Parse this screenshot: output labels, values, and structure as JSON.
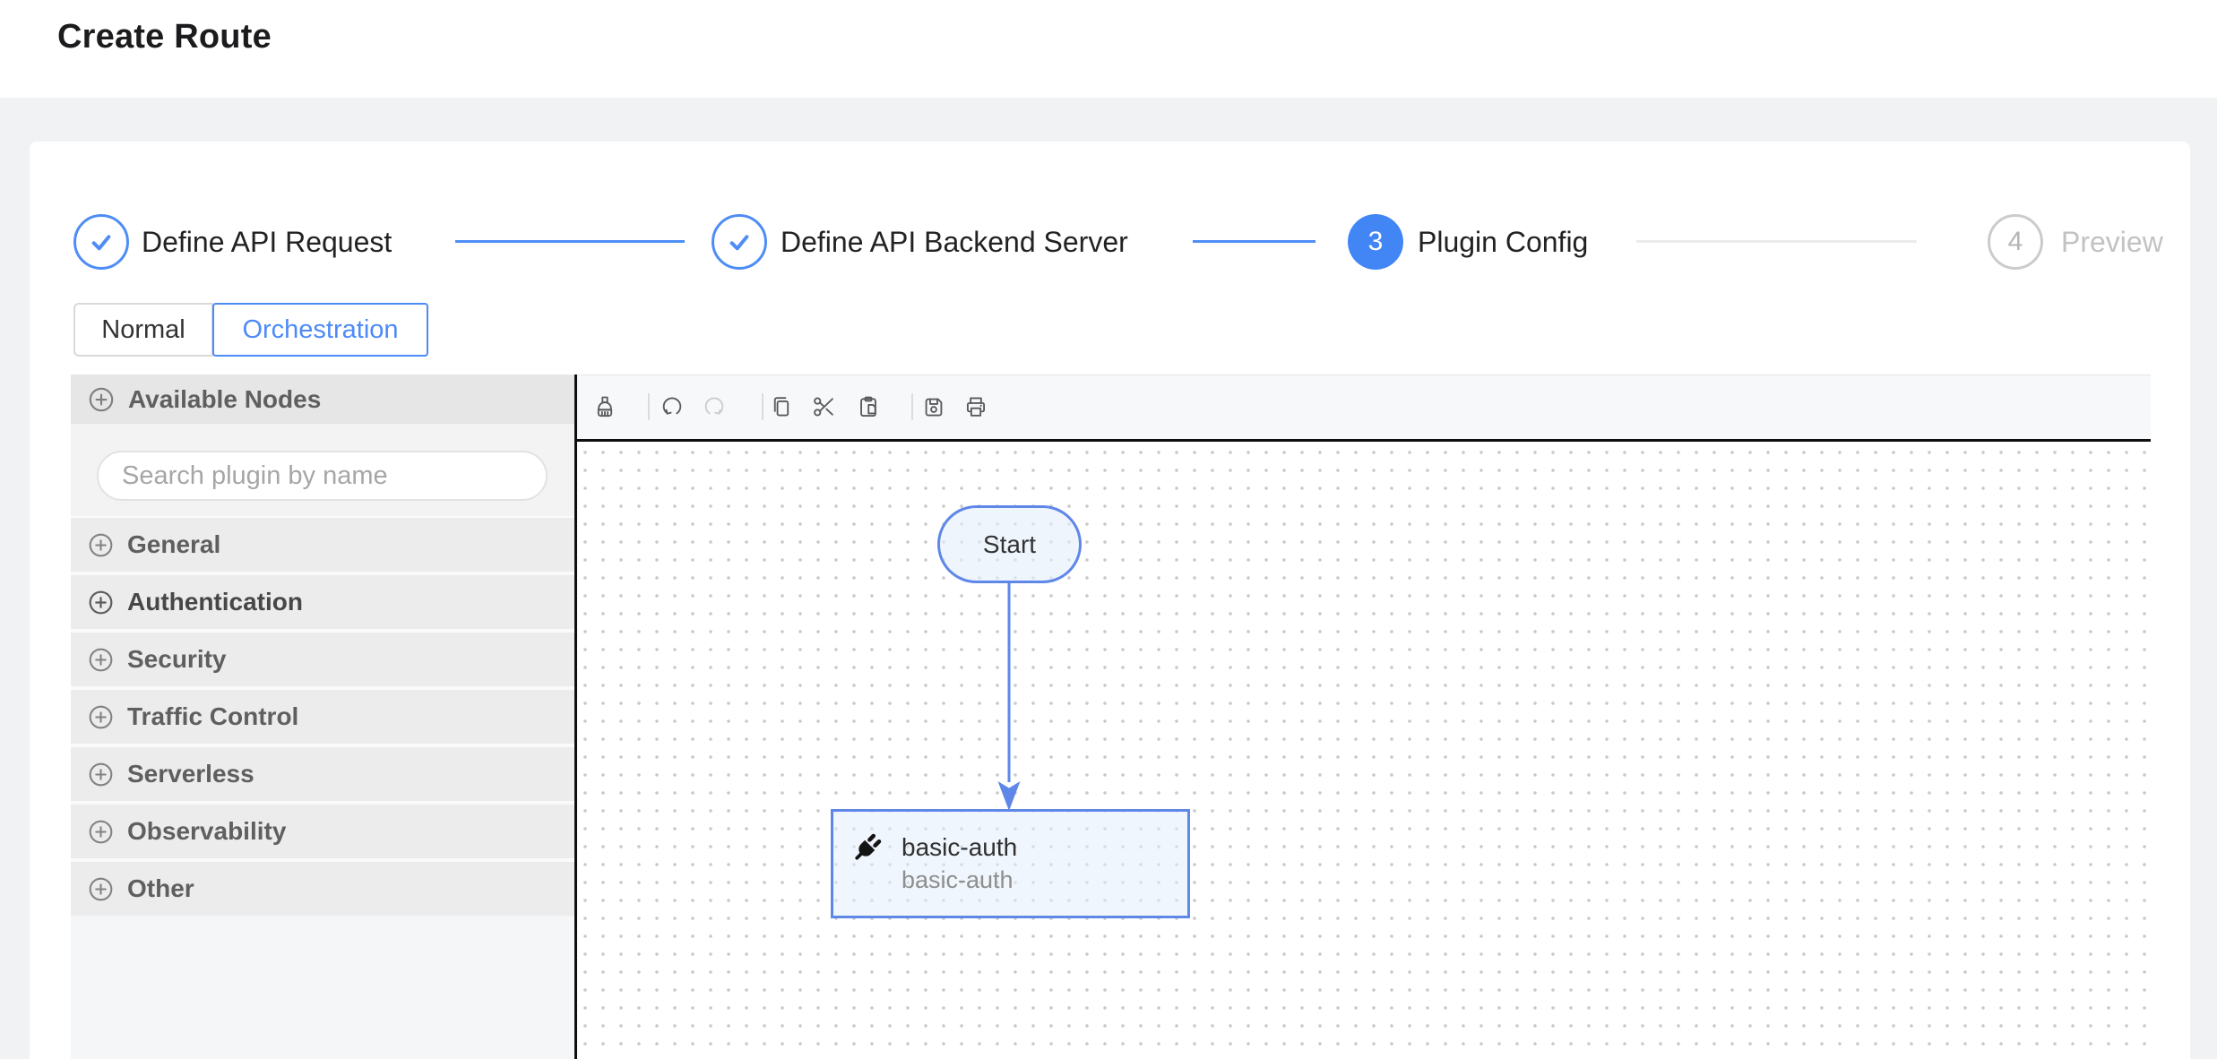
{
  "header": {
    "title": "Create Route"
  },
  "stepper": {
    "steps": [
      {
        "label": "Define API Request",
        "status": "done"
      },
      {
        "label": "Define API Backend Server",
        "status": "done"
      },
      {
        "label": "Plugin Config",
        "status": "active",
        "number": "3"
      },
      {
        "label": "Preview",
        "status": "pending",
        "number": "4"
      }
    ]
  },
  "mode_tabs": {
    "normal": "Normal",
    "orchestration": "Orchestration",
    "selected": "Orchestration"
  },
  "sidebar": {
    "header": "Available Nodes",
    "search_placeholder": "Search plugin by name",
    "categories": [
      {
        "label": "General"
      },
      {
        "label": "Authentication"
      },
      {
        "label": "Security"
      },
      {
        "label": "Traffic Control"
      },
      {
        "label": "Serverless"
      },
      {
        "label": "Observability"
      },
      {
        "label": "Other"
      }
    ]
  },
  "toolbar": {
    "buttons": [
      {
        "icon": "clear-broom-icon",
        "enabled": true
      },
      {
        "icon": "undo-icon",
        "enabled": true
      },
      {
        "icon": "redo-icon",
        "enabled": false
      },
      {
        "icon": "copy-icon",
        "enabled": true
      },
      {
        "icon": "cut-scissors-icon",
        "enabled": true
      },
      {
        "icon": "paste-icon",
        "enabled": true
      },
      {
        "icon": "save-floppy-icon",
        "enabled": true
      },
      {
        "icon": "print-icon",
        "enabled": true
      }
    ]
  },
  "canvas": {
    "nodes": [
      {
        "id": "start",
        "shape": "stadium",
        "label": "Start"
      },
      {
        "id": "basic-auth",
        "shape": "rect",
        "icon": "plugin-plug-icon",
        "title": "basic-auth",
        "subtitle": "basic-auth",
        "selected": true
      }
    ],
    "edges": [
      {
        "from": "start",
        "to": "basic-auth",
        "direction": "down",
        "arrow": true
      }
    ]
  },
  "colors": {
    "accent_blue": "#4285f4",
    "node_border_blue": "#5f87e8",
    "canvas_frame_black": "#0e0e0e",
    "sidebar_row_gray": "#ececec",
    "toolbar_bg": "#f7f8fa",
    "page_bg": "#f0f2f4",
    "pending_gray": "#c2c2c2"
  }
}
